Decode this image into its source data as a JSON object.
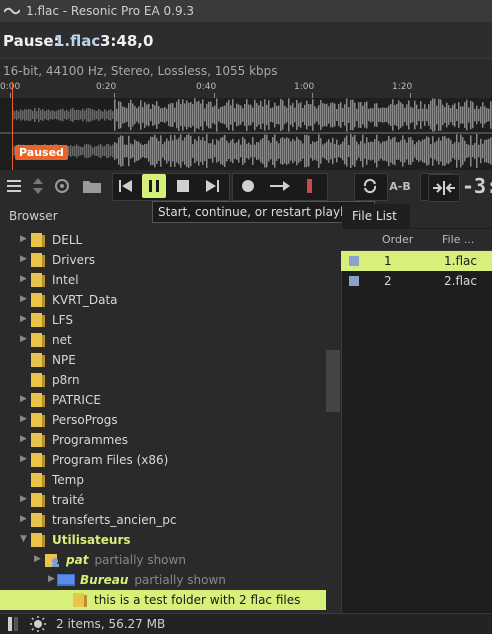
{
  "window": {
    "title": "1.flac - Resonic Pro EA 0.9.3"
  },
  "status": {
    "state": "Pause:",
    "file": "1.flac",
    "time": "3:48,0"
  },
  "info": "16-bit, 44100 Hz, Stereo, Lossless, 1055 kbps",
  "timeline": {
    "ticks": [
      "0:00",
      "0:20",
      "0:40",
      "1:00",
      "1:20"
    ]
  },
  "waveform": {
    "badge": "Paused",
    "playhead_fraction": 0.0
  },
  "toolbar": {
    "tooltip": "Start, continue, or restart playback",
    "ab_label": "A-B",
    "time_readout": "-3:"
  },
  "browser": {
    "tab_label": "Browser",
    "items": [
      {
        "label": "DELL",
        "expandable": true,
        "depth": 0
      },
      {
        "label": "Drivers",
        "expandable": true,
        "depth": 0
      },
      {
        "label": "Intel",
        "expandable": true,
        "depth": 0
      },
      {
        "label": "KVRT_Data",
        "expandable": true,
        "depth": 0
      },
      {
        "label": "LFS",
        "expandable": true,
        "depth": 0
      },
      {
        "label": "net",
        "expandable": true,
        "depth": 0
      },
      {
        "label": "NPE",
        "expandable": false,
        "depth": 0
      },
      {
        "label": "p8rn",
        "expandable": false,
        "depth": 0
      },
      {
        "label": "PATRICE",
        "expandable": true,
        "depth": 0
      },
      {
        "label": "PersoProgs",
        "expandable": true,
        "depth": 0
      },
      {
        "label": "Programmes",
        "expandable": true,
        "depth": 0
      },
      {
        "label": "Program Files (x86)",
        "expandable": true,
        "depth": 0
      },
      {
        "label": "Temp",
        "expandable": false,
        "depth": 0
      },
      {
        "label": "traité",
        "expandable": true,
        "depth": 0
      },
      {
        "label": "transferts_ancien_pc",
        "expandable": true,
        "depth": 0
      },
      {
        "label": "Utilisateurs",
        "expandable": true,
        "expanded": true,
        "depth": 0,
        "highlight": true
      },
      {
        "label": "pat",
        "expandable": true,
        "depth": 1,
        "highlight": true,
        "note": "partially shown",
        "user": true
      },
      {
        "label": "Bureau",
        "expandable": true,
        "depth": 2,
        "highlight": true,
        "note": "partially shown",
        "desktop": true
      },
      {
        "label": "this is a test folder with 2 flac files",
        "expandable": false,
        "depth": 3,
        "selected": true
      }
    ]
  },
  "filelist": {
    "tab_label": "File List",
    "columns": [
      "Order",
      "File ..."
    ],
    "rows": [
      {
        "order": "1",
        "file": "1.flac",
        "selected": true
      },
      {
        "order": "2",
        "file": "2.flac",
        "selected": false
      }
    ]
  },
  "bottom": {
    "summary": "2 items, 56.27 MB"
  },
  "colors": {
    "accent": "#d6f07a",
    "playhead": "#e8642a",
    "folder": "#e9c44b",
    "text_highlight": "#d6f07a"
  }
}
